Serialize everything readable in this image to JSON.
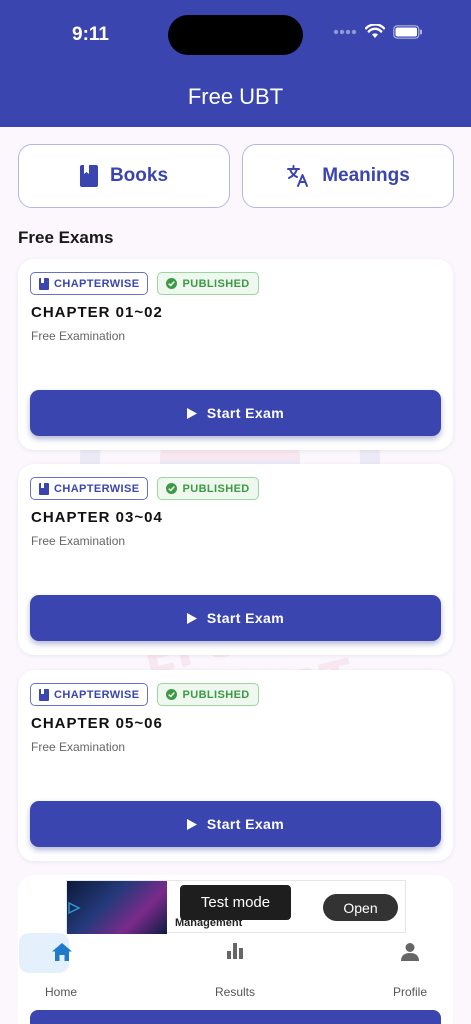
{
  "status_bar": {
    "time": "9:11"
  },
  "header": {
    "title": "Free UBT"
  },
  "quick_actions": {
    "books_label": "Books",
    "meanings_label": "Meanings"
  },
  "section": {
    "title": "Free Exams"
  },
  "exams": [
    {
      "category": "CHAPTERWISE",
      "status": "PUBLISHED",
      "title": "CHAPTER 01~02",
      "subtitle": "Free Examination",
      "action": "Start Exam"
    },
    {
      "category": "CHAPTERWISE",
      "status": "PUBLISHED",
      "title": "CHAPTER 03~04",
      "subtitle": "Free Examination",
      "action": "Start Exam"
    },
    {
      "category": "CHAPTERWISE",
      "status": "PUBLISHED",
      "title": "CHAPTER 05~06",
      "subtitle": "Free Examination",
      "action": "Start Exam"
    }
  ],
  "ad": {
    "badge": "Test mode",
    "open_label": "Open",
    "text_fragment": "Management"
  },
  "background_watermark": {
    "line1": "EPS TOPIK",
    "line2": "UBT"
  },
  "tab_bar": {
    "items": [
      {
        "label": "Home",
        "icon": "home-icon",
        "active": true
      },
      {
        "label": "Results",
        "icon": "bar-chart-icon",
        "active": false
      },
      {
        "label": "Profile",
        "icon": "person-icon",
        "active": false
      }
    ]
  },
  "colors": {
    "primary": "#3a45b0",
    "published": "#3c9a44",
    "active_tab": "#1f7ac9"
  }
}
